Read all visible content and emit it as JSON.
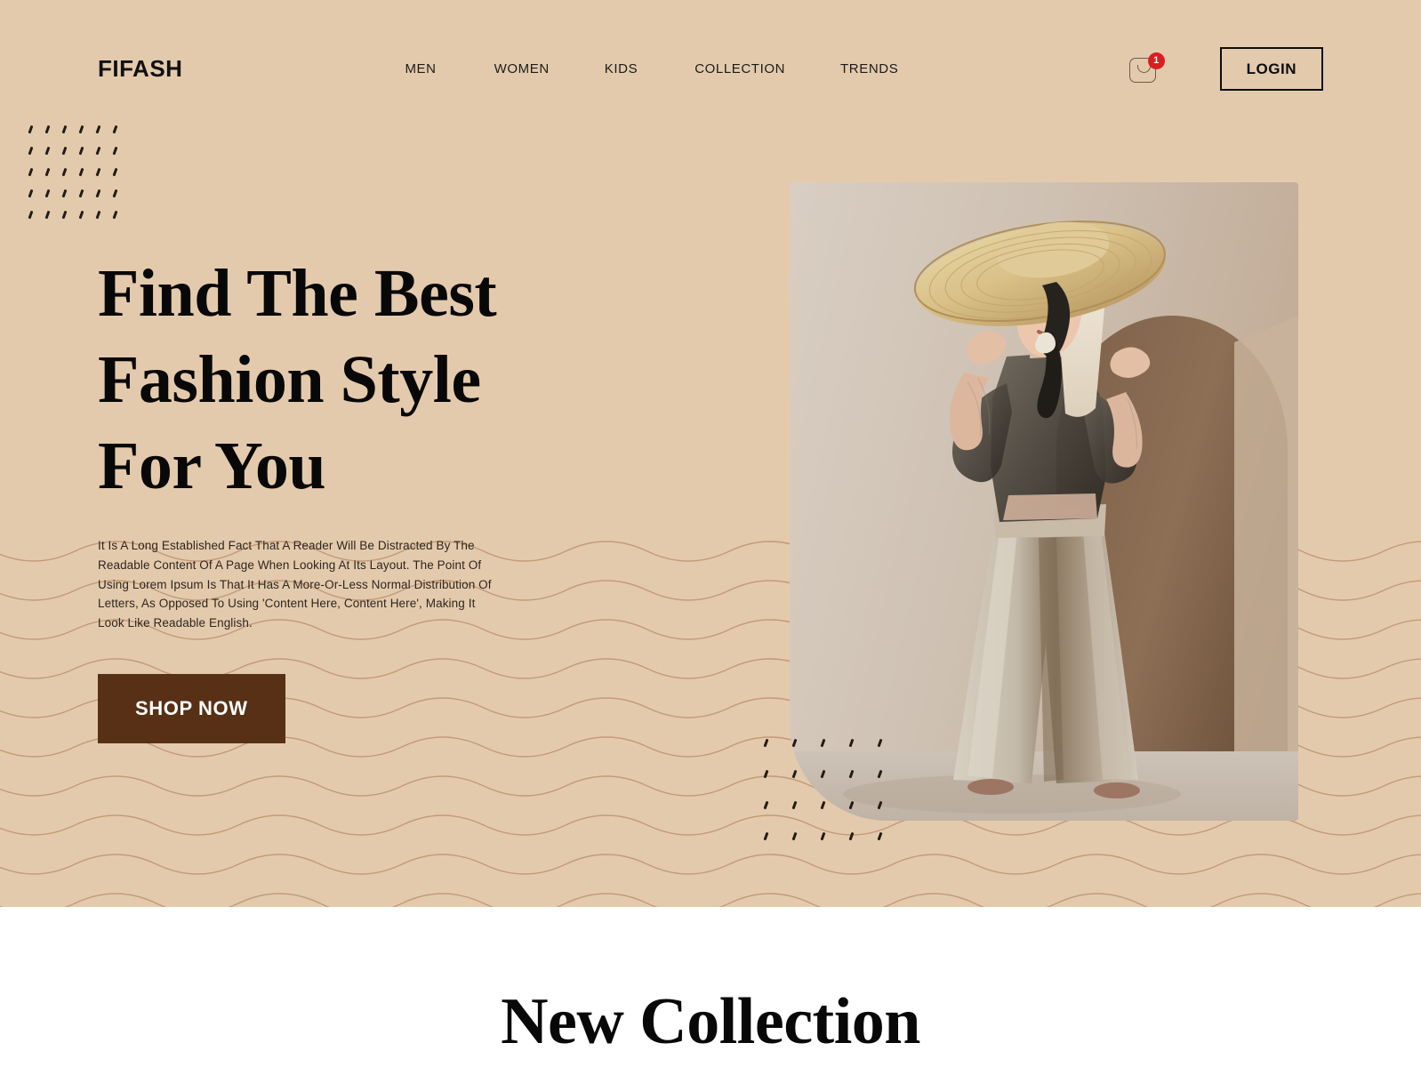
{
  "header": {
    "logo": "FIFASH",
    "nav": [
      {
        "label": "MEN"
      },
      {
        "label": "WOMEN"
      },
      {
        "label": "KIDS"
      },
      {
        "label": "COLLECTION"
      },
      {
        "label": "TRENDS"
      }
    ],
    "cart": {
      "icon": "shopping-bag-icon",
      "badge_count": "1",
      "badge_color": "#d81f20"
    },
    "login_label": "LOGIN"
  },
  "hero": {
    "title_line1": "Find The Best",
    "title_line2": "Fashion Style",
    "title_line3": "For You",
    "description": "It Is A Long Established Fact That A Reader Will Be Distracted By The Readable Content Of A Page When Looking At Its Layout. The Point Of Using Lorem Ipsum Is That It Has A More-Or-Less Normal Distribution Of Letters, As Opposed To Using 'Content Here, Content Here', Making It Look Like Readable English.",
    "cta_label": "SHOP NOW",
    "cta_color": "#573016",
    "background_color": "#e4caac",
    "image_alt": "Model wearing wide-brim straw hat, sheer black top and beige wide-leg trousers in front of an arched beige backdrop"
  },
  "collection": {
    "title": "New Collection"
  }
}
